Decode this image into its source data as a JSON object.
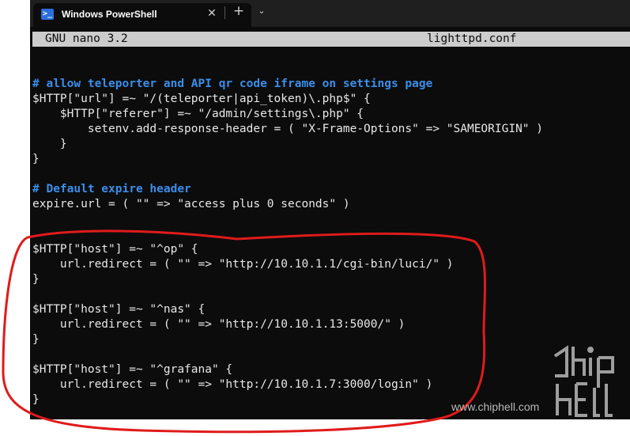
{
  "window": {
    "tab_title": "Windows PowerShell",
    "tab_icon": "powershell-icon",
    "close_icon": "✕",
    "new_tab_icon": "+",
    "dropdown_icon": "⌄"
  },
  "nano": {
    "version": "GNU nano 3.2",
    "filename": "lighttpd.conf"
  },
  "code_lines": [
    {
      "text": "# allow teleporter and API qr code iframe on settings page",
      "type": "comment"
    },
    {
      "text": "$HTTP[\"url\"] =~ \"/(teleporter|api_token)\\.php$\" {",
      "type": "code"
    },
    {
      "text": "    $HTTP[\"referer\"] =~ \"/admin/settings\\.php\" {",
      "type": "code"
    },
    {
      "text": "        setenv.add-response-header = ( \"X-Frame-Options\" => \"SAMEORIGIN\" )",
      "type": "code"
    },
    {
      "text": "    }",
      "type": "code"
    },
    {
      "text": "}",
      "type": "code"
    },
    {
      "text": "",
      "type": "blank"
    },
    {
      "text": "# Default expire header",
      "type": "comment"
    },
    {
      "text": "expire.url = ( \"\" => \"access plus 0 seconds\" )",
      "type": "code"
    },
    {
      "text": "",
      "type": "blank"
    },
    {
      "text": "",
      "type": "blank"
    },
    {
      "text": "$HTTP[\"host\"] =~ \"^op\" {",
      "type": "code"
    },
    {
      "text": "    url.redirect = ( \"\" => \"http://10.10.1.1/cgi-bin/luci/\" )",
      "type": "code"
    },
    {
      "text": "}",
      "type": "code"
    },
    {
      "text": "",
      "type": "blank"
    },
    {
      "text": "$HTTP[\"host\"] =~ \"^nas\" {",
      "type": "code"
    },
    {
      "text": "    url.redirect = ( \"\" => \"http://10.10.1.13:5000/\" )",
      "type": "code"
    },
    {
      "text": "}",
      "type": "code"
    },
    {
      "text": "",
      "type": "blank"
    },
    {
      "text": "$HTTP[\"host\"] =~ \"^grafana\" {",
      "type": "code"
    },
    {
      "text": "    url.redirect = ( \"\" => \"http://10.10.1.7:3000/login\" )",
      "type": "code"
    },
    {
      "text": "}",
      "type": "code"
    }
  ],
  "watermark": {
    "text": "www.chiphell.com",
    "logo_text": "chip hell"
  },
  "colors": {
    "terminal_bg": "#0c0c0c",
    "comment": "#3b8eea",
    "annotation": "#e01b1b"
  }
}
